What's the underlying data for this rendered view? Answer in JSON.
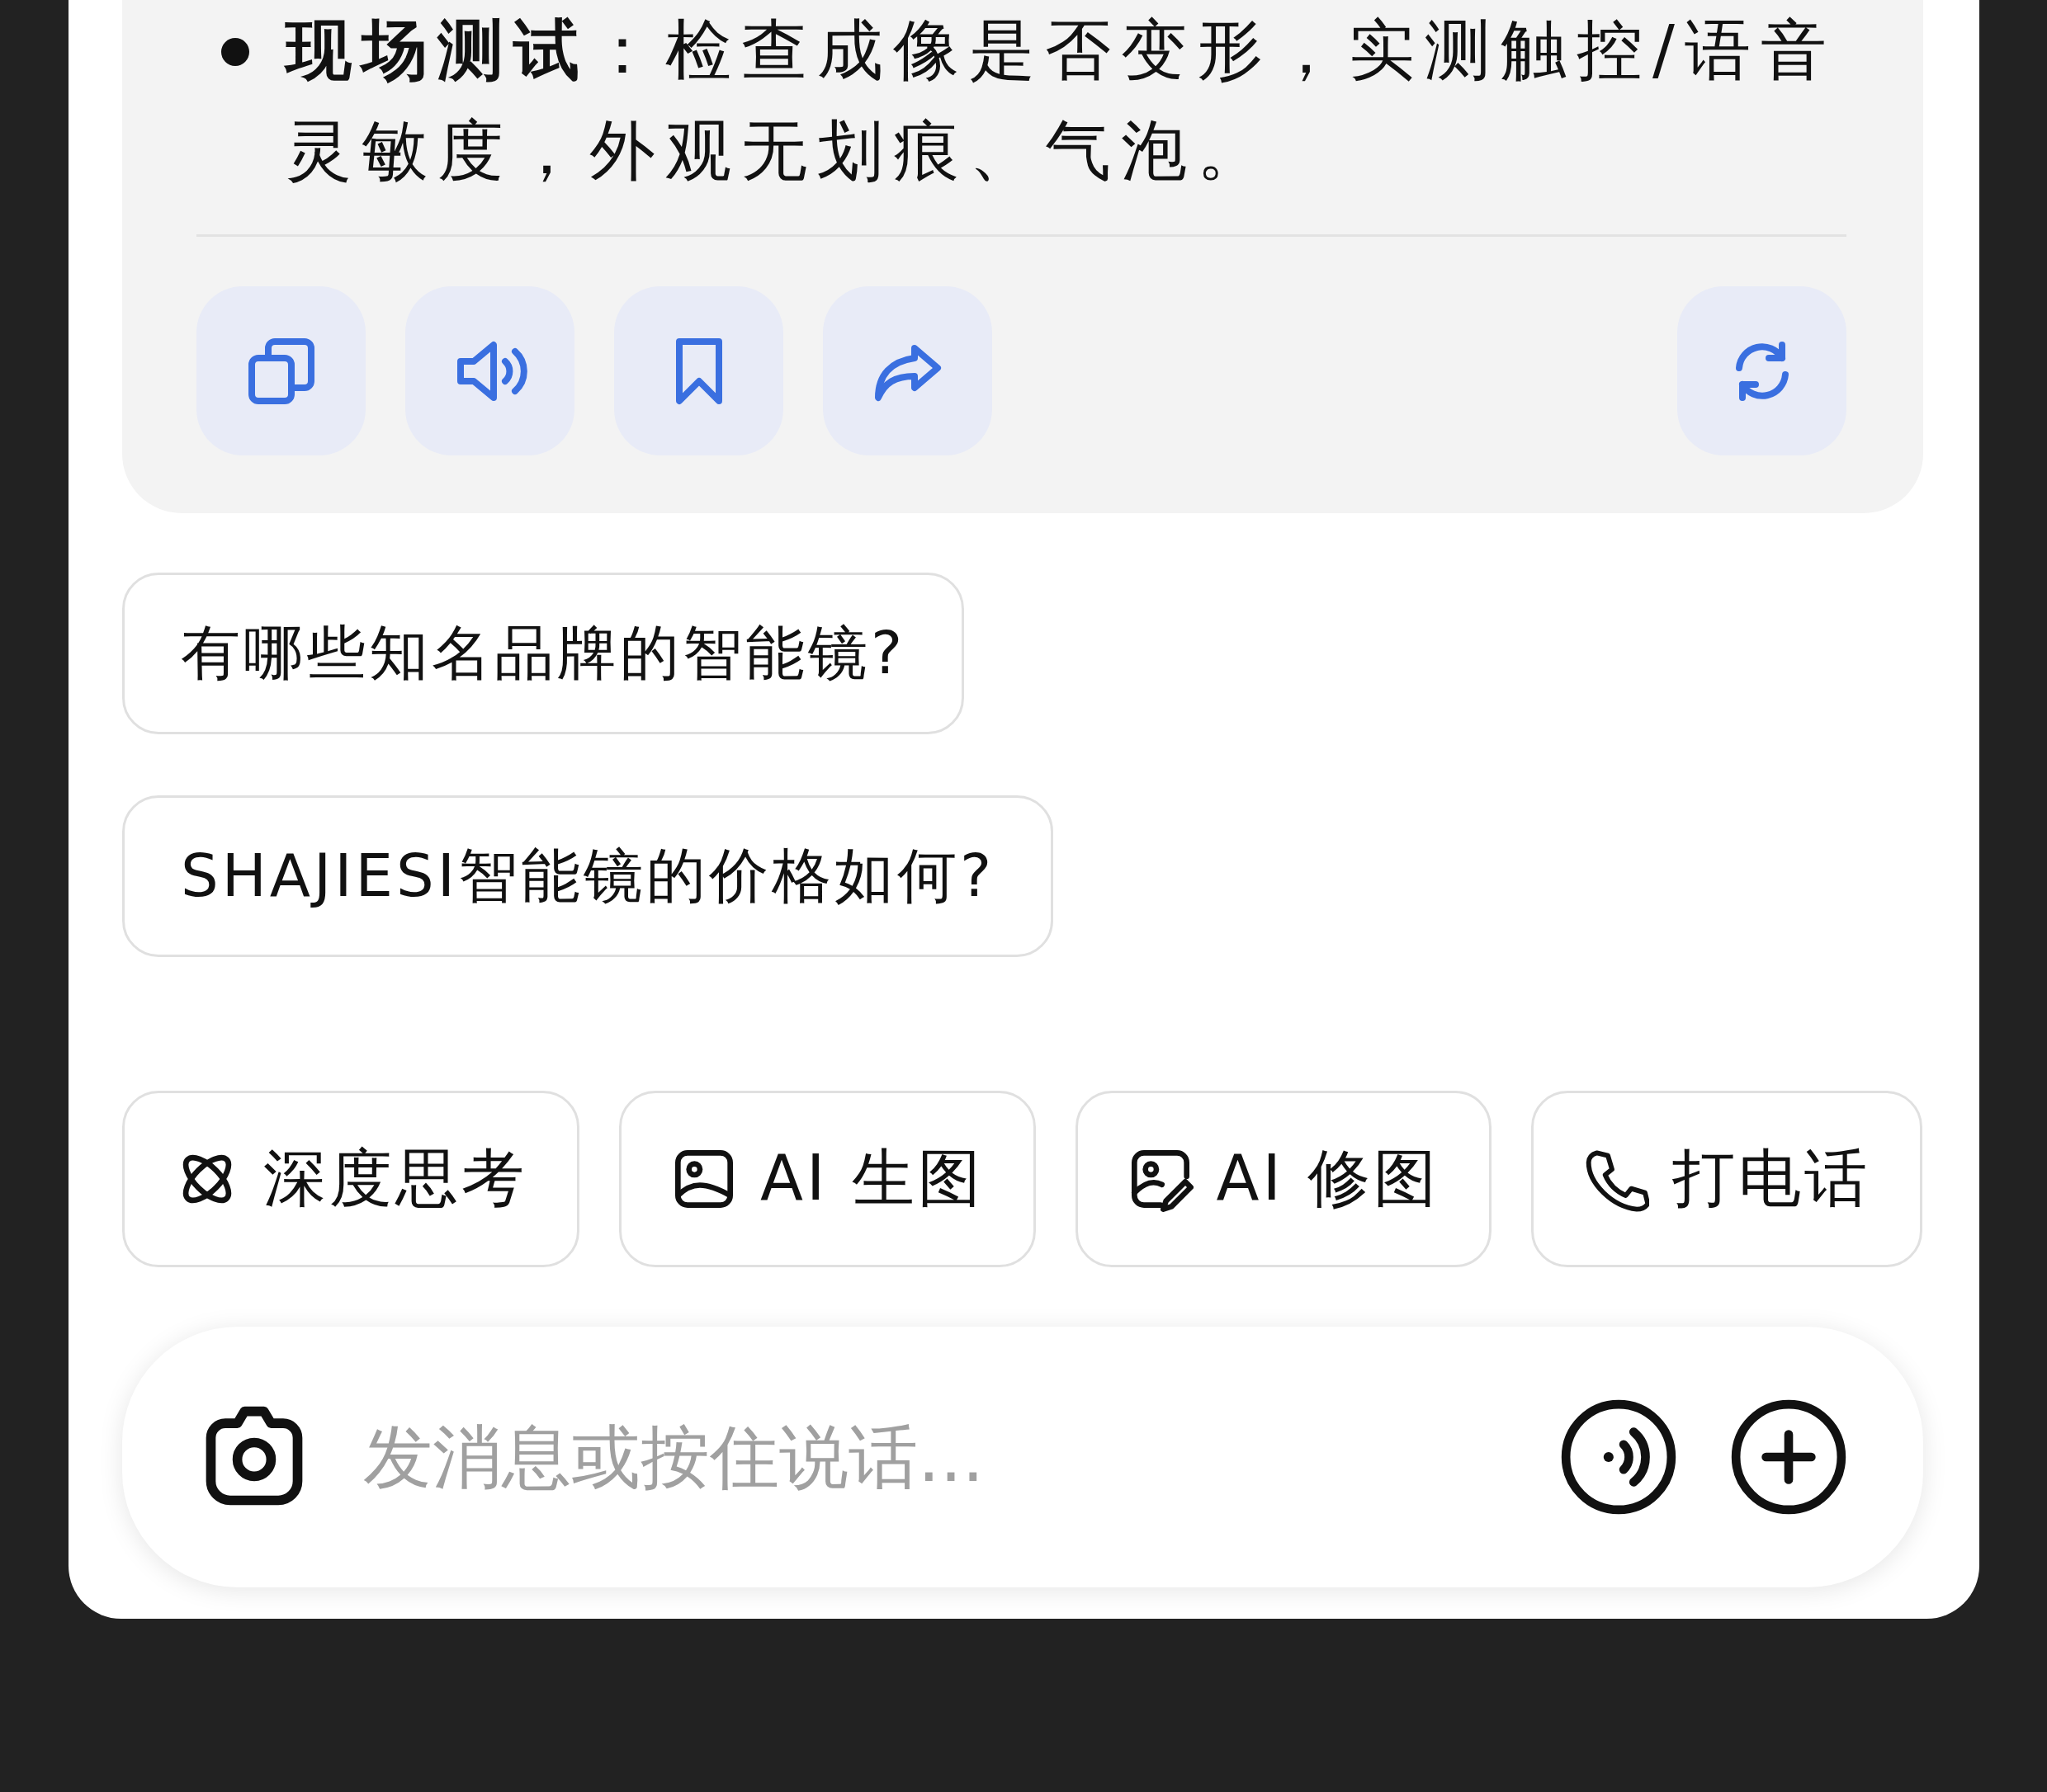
{
  "answer": {
    "bullets": [
      "**现场测试**：检查成像是否变形，实测触控/语音灵敏度，外观无划痕、气泡。"
    ],
    "actions": [
      {
        "kind": "copy"
      },
      {
        "kind": "speak"
      },
      {
        "kind": "bookmark"
      },
      {
        "kind": "share"
      }
    ],
    "regenerate": {
      "kind": "refresh"
    }
  },
  "suggestions": [
    "有哪些知名品牌的智能镜?",
    "SHAJIESI智能镜的价格如何?"
  ],
  "tools": [
    {
      "kind": "think",
      "label": "深度思考"
    },
    {
      "kind": "image",
      "label": "AI 生图"
    },
    {
      "kind": "edit",
      "label": "AI 修图"
    },
    {
      "kind": "call",
      "label": "打电话"
    }
  ],
  "input": {
    "placeholder": "发消息或按住说话..."
  }
}
